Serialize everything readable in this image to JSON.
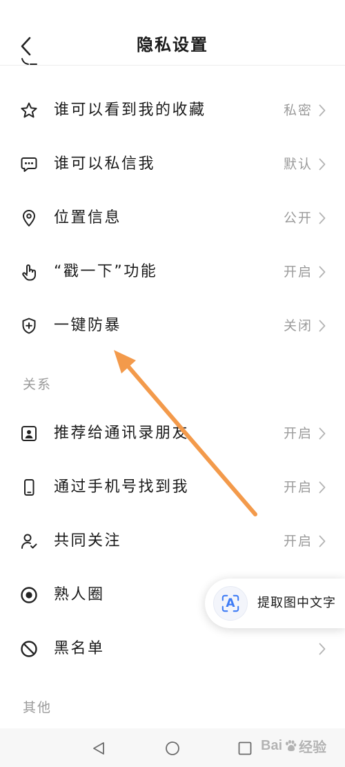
{
  "header": {
    "title": "隐私设置",
    "back_icon": "chevron-left-icon"
  },
  "privacy_items": [
    {
      "icon": "star-icon",
      "label": "谁可以看到我的收藏",
      "value": "私密"
    },
    {
      "icon": "chat-bubble-icon",
      "label": "谁可以私信我",
      "value": "默认"
    },
    {
      "icon": "location-pin-icon",
      "label": "位置信息",
      "value": "公开"
    },
    {
      "icon": "tap-hand-icon",
      "label": "“戳一下”功能",
      "value": "开启"
    },
    {
      "icon": "shield-plus-icon",
      "label": "一键防暴",
      "value": "关闭"
    }
  ],
  "relation_section": {
    "title": "关系",
    "items": [
      {
        "icon": "contact-card-icon",
        "label": "推荐给通讯录朋友",
        "value": "开启"
      },
      {
        "icon": "phone-icon",
        "label": "通过手机号找到我",
        "value": "开启"
      },
      {
        "icon": "person-check-icon",
        "label": "共同关注",
        "value": "开启"
      },
      {
        "icon": "target-circle-icon",
        "label": "熟人圈"
      },
      {
        "icon": "block-icon",
        "label": "黑名单"
      }
    ]
  },
  "other_section": {
    "title": "其他"
  },
  "floating_button": {
    "label": "提取图中文字",
    "icon": "text-scan-icon",
    "icon_letter": "A"
  },
  "system_nav": {
    "back": "nav-back-icon",
    "home": "nav-home-icon",
    "recent": "nav-recent-icon"
  },
  "watermark": {
    "prefix": "Bai",
    "icon": "paw-icon",
    "suffix": "经验"
  },
  "annotation": {
    "icon": "arrow-icon",
    "color": "#f39a4b"
  },
  "colors": {
    "text": "#1a1a1a",
    "secondary": "#9a9a9a",
    "chevron": "#b3b3b3",
    "accent_blue": "#3d7bf5"
  }
}
